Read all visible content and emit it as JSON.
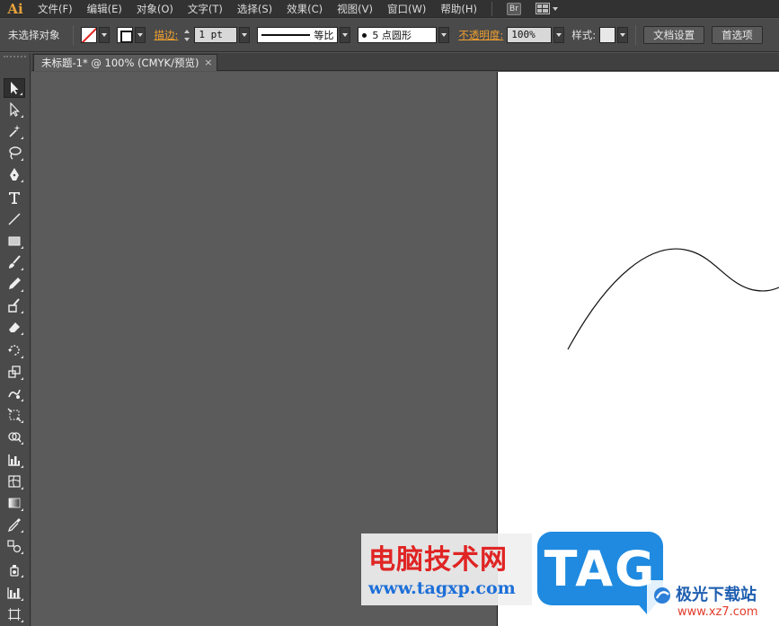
{
  "app": {
    "logo": "Ai",
    "bridge_badge": "Br",
    "menu": [
      "文件(F)",
      "编辑(E)",
      "对象(O)",
      "文字(T)",
      "选择(S)",
      "效果(C)",
      "视图(V)",
      "窗口(W)",
      "帮助(H)"
    ]
  },
  "control_bar": {
    "selection_status": "未选择对象",
    "stroke_label": "描边:",
    "stroke_weight": "1 pt",
    "stroke_profile": "等比",
    "brush_definition": "5 点圆形",
    "opacity_label": "不透明度:",
    "opacity_value": "100%",
    "style_label": "样式:",
    "doc_setup_button": "文档设置",
    "preferences_button": "首选项"
  },
  "document": {
    "tab_title": "未标题-1* @ 100% (CMYK/预览)",
    "tab_close": "×"
  },
  "tools": [
    {
      "name": "selection-tool",
      "icon": "arrow-black-icon"
    },
    {
      "name": "direct-selection-tool",
      "icon": "arrow-white-icon"
    },
    {
      "name": "magic-wand-tool",
      "icon": "magic-wand-icon"
    },
    {
      "name": "lasso-tool",
      "icon": "lasso-icon"
    },
    {
      "name": "pen-tool",
      "icon": "pen-icon"
    },
    {
      "name": "type-tool",
      "icon": "type-icon"
    },
    {
      "name": "line-tool",
      "icon": "line-icon"
    },
    {
      "name": "rectangle-tool",
      "icon": "rectangle-icon"
    },
    {
      "name": "paintbrush-tool",
      "icon": "brush-icon"
    },
    {
      "name": "pencil-tool",
      "icon": "pencil-icon"
    },
    {
      "name": "blob-brush-tool",
      "icon": "blob-brush-icon"
    },
    {
      "name": "eraser-tool",
      "icon": "eraser-icon"
    },
    {
      "name": "rotate-tool",
      "icon": "rotate-icon"
    },
    {
      "name": "scale-tool",
      "icon": "scale-icon"
    },
    {
      "name": "warp-tool",
      "icon": "warp-icon"
    },
    {
      "name": "free-transform-tool",
      "icon": "free-transform-icon"
    },
    {
      "name": "shape-builder-tool",
      "icon": "shape-builder-icon"
    },
    {
      "name": "graph-tool",
      "icon": "graph-icon"
    },
    {
      "name": "mesh-tool",
      "icon": "mesh-icon"
    },
    {
      "name": "gradient-tool",
      "icon": "gradient-icon"
    },
    {
      "name": "eyedropper-tool",
      "icon": "eyedropper-icon"
    },
    {
      "name": "blend-tool",
      "icon": "blend-icon"
    },
    {
      "name": "symbol-sprayer-tool",
      "icon": "symbol-sprayer-icon"
    },
    {
      "name": "column-graph-tool",
      "icon": "column-graph-icon"
    },
    {
      "name": "artboard-tool",
      "icon": "artboard-icon"
    }
  ],
  "watermark": {
    "cn_title": "电脑技术网",
    "cn_url": "www.tagxp.com",
    "tag": "TAG",
    "site_name": "极光下载站",
    "site_url": "www.xz7.com"
  }
}
